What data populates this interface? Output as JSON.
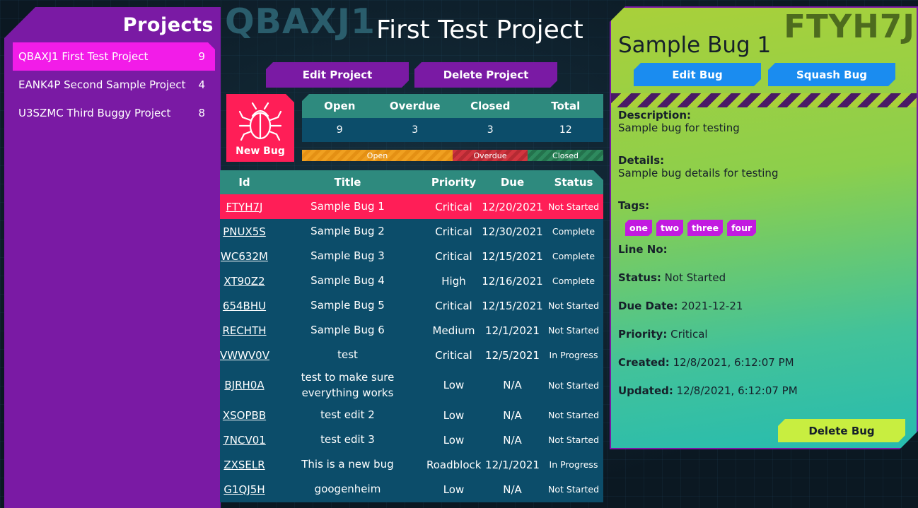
{
  "sidebar": {
    "title": "Projects",
    "items": [
      {
        "label": "QBAXJ1 First Test Project",
        "count": "9"
      },
      {
        "label": "EANK4P Second Sample Project",
        "count": "4"
      },
      {
        "label": "U3SZMC Third Buggy Project",
        "count": "8"
      }
    ]
  },
  "project": {
    "id": "QBAXJ1",
    "name": "First Test Project",
    "edit_label": "Edit Project",
    "delete_label": "Delete Project",
    "new_bug_label": "New Bug"
  },
  "stats": {
    "headers": [
      "Open",
      "Overdue",
      "Closed",
      "Total"
    ],
    "values": [
      "9",
      "3",
      "3",
      "12"
    ]
  },
  "status_bar": {
    "open_label": "Open",
    "overdue_label": "Overdue",
    "closed_label": "Closed",
    "colors": {
      "open": "#f0a020",
      "overdue": "#d2353f",
      "closed": "#2e8a5e"
    }
  },
  "bug_table": {
    "headers": {
      "id": "Id",
      "title": "Title",
      "priority": "Priority",
      "due": "Due",
      "status": "Status"
    },
    "rows": [
      {
        "id": "FTYH7J",
        "title": "Sample Bug 1",
        "priority": "Critical",
        "due": "12/20/2021",
        "status": "Not Started"
      },
      {
        "id": "PNUX5S",
        "title": "Sample Bug 2",
        "priority": "Critical",
        "due": "12/30/2021",
        "status": "Complete"
      },
      {
        "id": "WC632M",
        "title": "Sample Bug 3",
        "priority": "Critical",
        "due": "12/15/2021",
        "status": "Complete"
      },
      {
        "id": "XT90Z2",
        "title": "Sample Bug 4",
        "priority": "High",
        "due": "12/16/2021",
        "status": "Complete"
      },
      {
        "id": "654BHU",
        "title": "Sample Bug 5",
        "priority": "Critical",
        "due": "12/15/2021",
        "status": "Not Started"
      },
      {
        "id": "RECHTH",
        "title": "Sample Bug 6",
        "priority": "Medium",
        "due": "12/1/2021",
        "status": "Not Started"
      },
      {
        "id": "VWWV0V",
        "title": "test",
        "priority": "Critical",
        "due": "12/5/2021",
        "status": "In Progress"
      },
      {
        "id": "BJRH0A",
        "title": "test to make sure everything works",
        "priority": "Low",
        "due": "N/A",
        "status": "Not Started"
      },
      {
        "id": "XSOPBB",
        "title": "test edit 2",
        "priority": "Low",
        "due": "N/A",
        "status": "Not Started"
      },
      {
        "id": "7NCV01",
        "title": "test edit 3",
        "priority": "Low",
        "due": "N/A",
        "status": "Not Started"
      },
      {
        "id": "ZXSELR",
        "title": "This is a new bug",
        "priority": "Roadblock",
        "due": "12/1/2021",
        "status": "In Progress"
      },
      {
        "id": "G1QJ5H",
        "title": "googenheim",
        "priority": "Low",
        "due": "N/A",
        "status": "Not Started"
      }
    ]
  },
  "details": {
    "bug_id": "FTYH7J",
    "bug_title": "Sample Bug 1",
    "edit_label": "Edit Bug",
    "squash_label": "Squash Bug",
    "description_label": "Description:",
    "description": "Sample bug for testing",
    "details_label": "Details:",
    "details": "Sample bug details for testing",
    "tags_label": "Tags:",
    "tags": [
      "one",
      "two",
      "three",
      "four"
    ],
    "line_no_label": "Line No:",
    "status_label": "Status:",
    "status": "Not Started",
    "due_label": "Due Date:",
    "due": "2021-12-21",
    "priority_label": "Priority:",
    "priority": "Critical",
    "created_label": "Created:",
    "created": "12/8/2021, 6:12:07 PM",
    "updated_label": "Updated:",
    "updated": "12/8/2021, 6:12:07 PM",
    "delete_label": "Delete Bug"
  }
}
